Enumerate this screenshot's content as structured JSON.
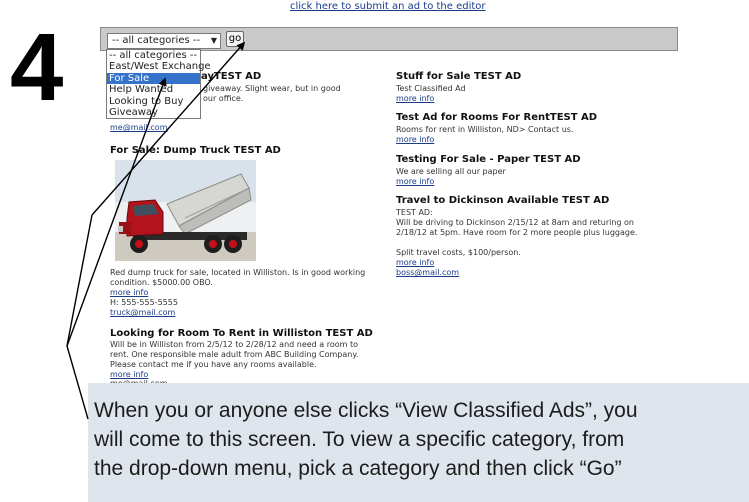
{
  "step_number": "4",
  "header": {
    "submit_link": "click here to submit an ad to the editor"
  },
  "filter": {
    "selected_value": "-- all categories --",
    "dropdown_arrow": "▼",
    "go_label": "go",
    "options": [
      "-- all categories --",
      "East/West Exchange",
      "For Sale",
      "Help Wanted",
      "Looking to Buy",
      "Giveaway"
    ],
    "highlighted_option": "For Sale"
  },
  "ads_left": [
    {
      "title_visible": "ayTEST AD",
      "body_lines": [
        "giveaway. Slight wear, but in good",
        "our office."
      ],
      "email": "me@mail.com"
    },
    {
      "title": "For Sale: Dump Truck TEST AD",
      "body_lines": [
        "Red dump truck for sale, located in Williston. Is in good working",
        "condition. $5000.00 OBO."
      ],
      "more_info": "more info",
      "phone": "H: 555-555-5555",
      "email": "truck@mail.com"
    },
    {
      "title": "Looking for Room To Rent in Williston TEST AD",
      "body_lines": [
        "Will be in Williston from 2/5/12 to 2/28/12 and need a room to",
        "rent. One responsible male adult from ABC Building Company.",
        "Please contact me if you have any rooms available."
      ],
      "more_info": "more info",
      "email": "me@mail.com"
    }
  ],
  "ads_right": [
    {
      "title": "Stuff for Sale TEST AD",
      "body_lines": [
        "Test Classified Ad"
      ],
      "more_info": "more info"
    },
    {
      "title": "Test Ad for Rooms For RentTEST AD",
      "body_lines": [
        "Rooms for rent in Williston, ND> Contact us."
      ],
      "more_info": "more info"
    },
    {
      "title": "Testing For Sale - Paper TEST AD",
      "body_lines": [
        "We are selling all our paper"
      ],
      "more_info": "more info"
    },
    {
      "title": "Travel to Dickinson Available TEST AD",
      "body_lines": [
        "TEST AD:",
        "Will be driving to Dickinson 2/15/12 at 8am and returing on",
        "2/18/12 at 5pm. Have room for 2 more people plus luggage."
      ],
      "extra_line": "Split travel costs, $100/person.",
      "more_info": "more info",
      "email": "boss@mail.com"
    }
  ],
  "caption": {
    "line1": "When you or anyone else clicks “View Classified Ads”, you",
    "line2": "will come to this screen. To view a specific category, from",
    "line3": "the drop-down menu, pick a category and then click “Go”"
  },
  "colors": {
    "link": "#1a3d8a",
    "filter_bar": "#c9c9c9",
    "highlight": "#3572c9",
    "caption_bg": "#dfe5ec",
    "truck_red": "#b3141c"
  }
}
